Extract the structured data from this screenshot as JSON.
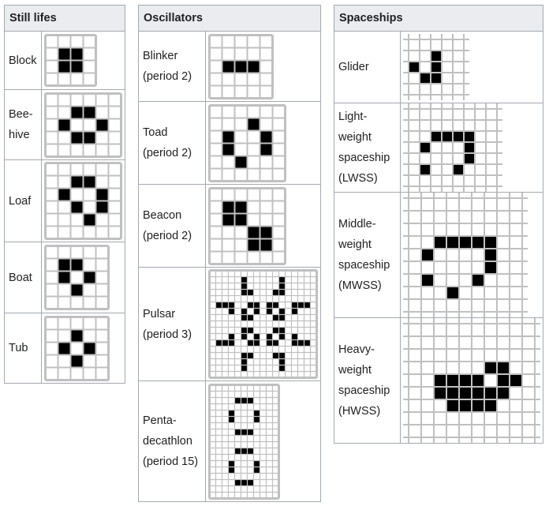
{
  "tables": [
    {
      "header": "Still lifes",
      "rows": [
        {
          "label": "Block",
          "grid": {
            "style": "bordered",
            "cols": 4,
            "rows": 4,
            "live": [
              [
                1,
                1
              ],
              [
                1,
                2
              ],
              [
                2,
                1
              ],
              [
                2,
                2
              ]
            ]
          }
        },
        {
          "label": "Bee-\nhive",
          "grid": {
            "style": "bordered",
            "cols": 6,
            "rows": 5,
            "live": [
              [
                1,
                2
              ],
              [
                1,
                3
              ],
              [
                2,
                1
              ],
              [
                2,
                4
              ],
              [
                3,
                2
              ],
              [
                3,
                3
              ]
            ]
          }
        },
        {
          "label": "Loaf",
          "grid": {
            "style": "bordered",
            "cols": 6,
            "rows": 6,
            "live": [
              [
                1,
                2
              ],
              [
                1,
                3
              ],
              [
                2,
                1
              ],
              [
                2,
                4
              ],
              [
                3,
                2
              ],
              [
                3,
                4
              ],
              [
                4,
                3
              ]
            ]
          }
        },
        {
          "label": "Boat",
          "grid": {
            "style": "bordered",
            "cols": 5,
            "rows": 5,
            "live": [
              [
                1,
                1
              ],
              [
                1,
                2
              ],
              [
                2,
                1
              ],
              [
                2,
                3
              ],
              [
                3,
                2
              ]
            ]
          }
        },
        {
          "label": "Tub",
          "grid": {
            "style": "bordered",
            "cols": 5,
            "rows": 5,
            "live": [
              [
                1,
                2
              ],
              [
                2,
                1
              ],
              [
                2,
                3
              ],
              [
                3,
                2
              ]
            ]
          }
        }
      ]
    },
    {
      "header": "Oscillators",
      "rows": [
        {
          "label": "Blinker\n(period 2)",
          "grid": {
            "style": "bordered",
            "cols": 5,
            "rows": 5,
            "live": [
              [
                2,
                1
              ],
              [
                2,
                2
              ],
              [
                2,
                3
              ]
            ]
          }
        },
        {
          "label": "Toad\n(period 2)",
          "grid": {
            "style": "bordered",
            "cols": 6,
            "rows": 6,
            "live": [
              [
                1,
                3
              ],
              [
                2,
                1
              ],
              [
                2,
                4
              ],
              [
                3,
                1
              ],
              [
                3,
                4
              ],
              [
                4,
                2
              ]
            ]
          }
        },
        {
          "label": "Beacon\n(period 2)",
          "grid": {
            "style": "bordered",
            "cols": 6,
            "rows": 6,
            "live": [
              [
                1,
                1
              ],
              [
                1,
                2
              ],
              [
                2,
                1
              ],
              [
                2,
                2
              ],
              [
                3,
                3
              ],
              [
                3,
                4
              ],
              [
                4,
                3
              ],
              [
                4,
                4
              ]
            ]
          }
        },
        {
          "label": "Pulsar\n(period 3)",
          "grid": {
            "style": "bordered",
            "cols": 17,
            "rows": 17,
            "live": [
              [
                1,
                5
              ],
              [
                1,
                11
              ],
              [
                2,
                5
              ],
              [
                2,
                11
              ],
              [
                3,
                5
              ],
              [
                3,
                6
              ],
              [
                3,
                10
              ],
              [
                3,
                11
              ],
              [
                5,
                1
              ],
              [
                5,
                2
              ],
              [
                5,
                3
              ],
              [
                5,
                6
              ],
              [
                5,
                7
              ],
              [
                5,
                9
              ],
              [
                5,
                10
              ],
              [
                5,
                13
              ],
              [
                5,
                14
              ],
              [
                5,
                15
              ],
              [
                6,
                3
              ],
              [
                6,
                5
              ],
              [
                6,
                7
              ],
              [
                6,
                9
              ],
              [
                6,
                11
              ],
              [
                6,
                13
              ],
              [
                7,
                5
              ],
              [
                7,
                6
              ],
              [
                7,
                10
              ],
              [
                7,
                11
              ],
              [
                9,
                5
              ],
              [
                9,
                6
              ],
              [
                9,
                10
              ],
              [
                9,
                11
              ],
              [
                10,
                3
              ],
              [
                10,
                5
              ],
              [
                10,
                7
              ],
              [
                10,
                9
              ],
              [
                10,
                11
              ],
              [
                10,
                13
              ],
              [
                11,
                1
              ],
              [
                11,
                2
              ],
              [
                11,
                3
              ],
              [
                11,
                6
              ],
              [
                11,
                7
              ],
              [
                11,
                9
              ],
              [
                11,
                10
              ],
              [
                11,
                13
              ],
              [
                11,
                14
              ],
              [
                11,
                15
              ],
              [
                13,
                5
              ],
              [
                13,
                6
              ],
              [
                13,
                10
              ],
              [
                13,
                11
              ],
              [
                14,
                5
              ],
              [
                14,
                11
              ],
              [
                15,
                5
              ],
              [
                15,
                11
              ]
            ]
          }
        },
        {
          "label": "Penta-\ndecathlon\n(period 15)",
          "grid": {
            "style": "bordered",
            "cols": 11,
            "rows": 18,
            "live": [
              [
                2,
                4
              ],
              [
                2,
                5
              ],
              [
                2,
                6
              ],
              [
                4,
                3
              ],
              [
                4,
                7
              ],
              [
                5,
                3
              ],
              [
                5,
                7
              ],
              [
                7,
                4
              ],
              [
                7,
                5
              ],
              [
                7,
                6
              ],
              [
                10,
                4
              ],
              [
                10,
                5
              ],
              [
                10,
                6
              ],
              [
                12,
                3
              ],
              [
                12,
                7
              ],
              [
                13,
                3
              ],
              [
                13,
                7
              ],
              [
                15,
                4
              ],
              [
                15,
                5
              ],
              [
                15,
                6
              ]
            ]
          }
        }
      ]
    },
    {
      "header": "Spaceships",
      "rows": [
        {
          "label": "Glider",
          "grid": {
            "style": "open",
            "cols": 5,
            "rows": 5,
            "live": [
              [
                1,
                2
              ],
              [
                2,
                0
              ],
              [
                2,
                2
              ],
              [
                3,
                1
              ],
              [
                3,
                2
              ]
            ]
          }
        },
        {
          "label": "Light-\nweight\nspaceship\n(LWSS)",
          "grid": {
            "style": "open",
            "cols": 8,
            "rows": 7,
            "live": [
              [
                2,
                2
              ],
              [
                2,
                3
              ],
              [
                2,
                4
              ],
              [
                2,
                5
              ],
              [
                3,
                1
              ],
              [
                3,
                5
              ],
              [
                4,
                5
              ],
              [
                5,
                1
              ],
              [
                5,
                4
              ]
            ]
          }
        },
        {
          "label": "Middle-\nweight\nspaceship\n(MWSS)",
          "grid": {
            "style": "open",
            "cols": 9,
            "rows": 9,
            "live": [
              [
                3,
                2
              ],
              [
                3,
                3
              ],
              [
                3,
                4
              ],
              [
                3,
                5
              ],
              [
                3,
                6
              ],
              [
                4,
                1
              ],
              [
                4,
                6
              ],
              [
                5,
                6
              ],
              [
                6,
                1
              ],
              [
                6,
                5
              ],
              [
                7,
                3
              ]
            ]
          }
        },
        {
          "label": "Heavy-\nweight\nspaceship\n(HWSS)",
          "grid": {
            "style": "open",
            "cols": 10,
            "rows": 9,
            "live": [
              [
                3,
                6
              ],
              [
                3,
                7
              ],
              [
                4,
                2
              ],
              [
                4,
                3
              ],
              [
                4,
                4
              ],
              [
                4,
                5
              ],
              [
                4,
                7
              ],
              [
                4,
                8
              ],
              [
                5,
                2
              ],
              [
                5,
                3
              ],
              [
                5,
                4
              ],
              [
                5,
                5
              ],
              [
                5,
                6
              ],
              [
                5,
                7
              ],
              [
                6,
                3
              ],
              [
                6,
                4
              ],
              [
                6,
                5
              ],
              [
                6,
                6
              ]
            ]
          }
        }
      ]
    }
  ],
  "colors": {
    "header_bg": "#eaecf0",
    "border": "#a2a9b1",
    "grid_line": "#c0c0c0",
    "live_cell": "#000000",
    "dead_cell": "#ffffff"
  }
}
